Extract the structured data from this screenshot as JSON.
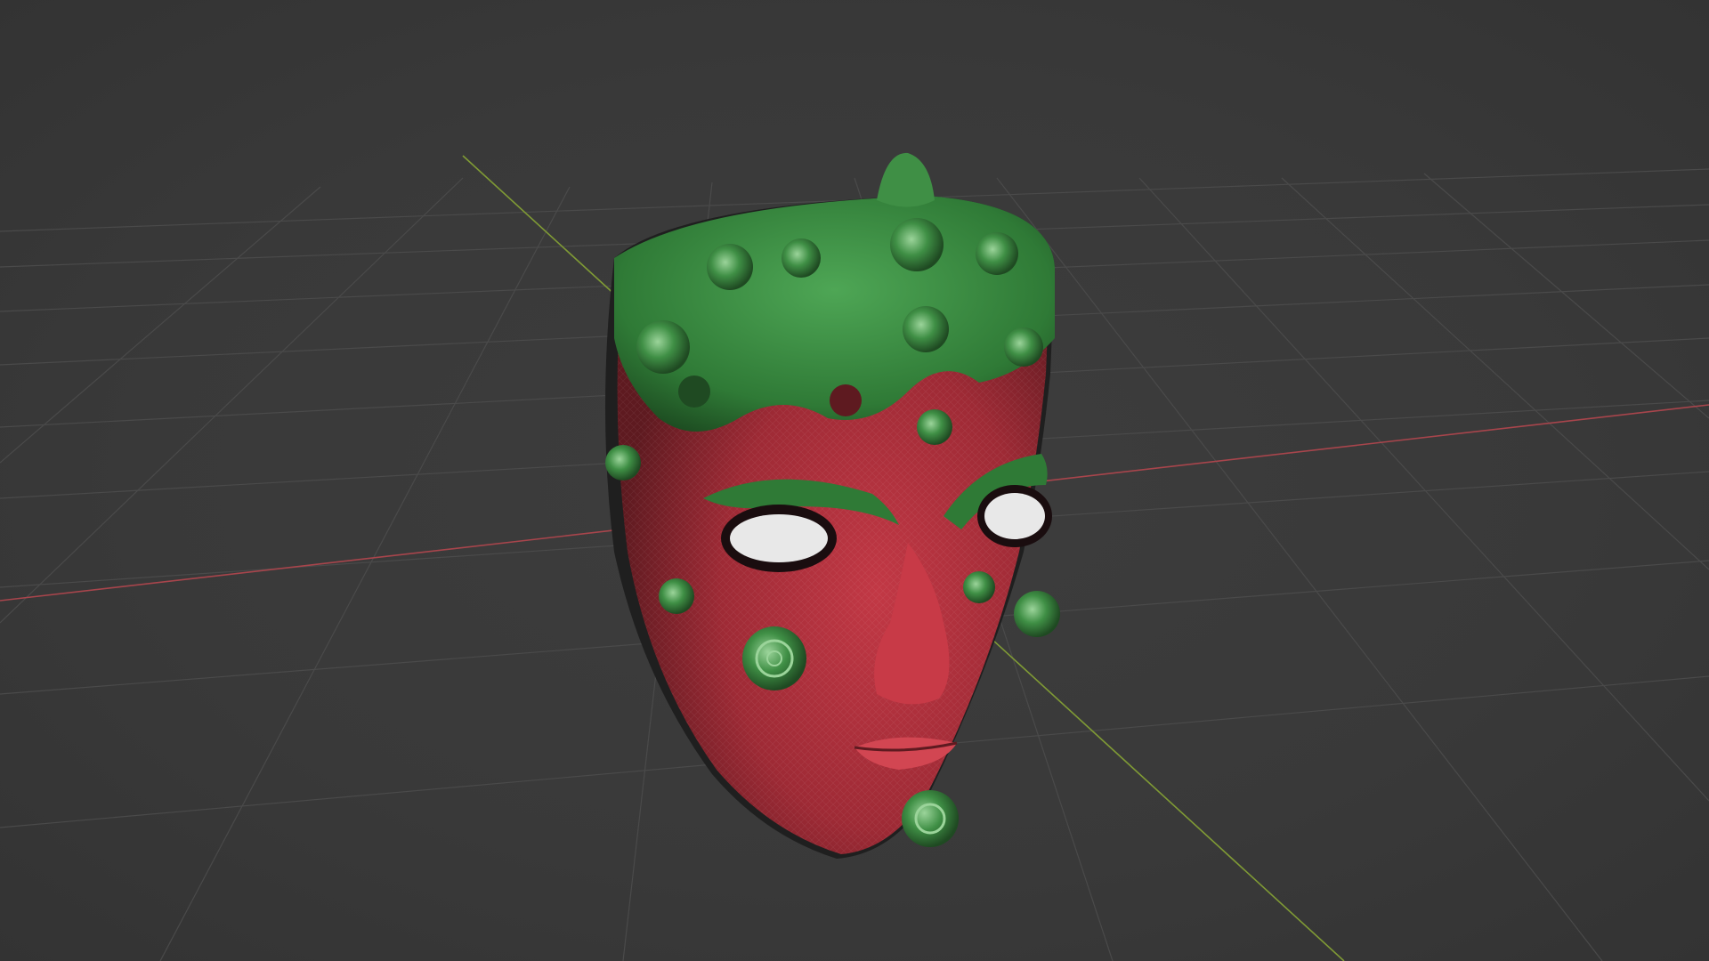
{
  "viewport": {
    "background_color": "#3a3a3a",
    "grid_color": "#4a4a4a",
    "x_axis_color": "#a8454c",
    "y_axis_color": "#7f9a35"
  },
  "scene_object": {
    "name": "mask-mesh",
    "colors": {
      "base_red": "#b52f3a",
      "dark_red": "#6e1d24",
      "green": "#3f8f45",
      "dark_green": "#1f4a22",
      "eye_white": "#e8e8e8"
    }
  }
}
